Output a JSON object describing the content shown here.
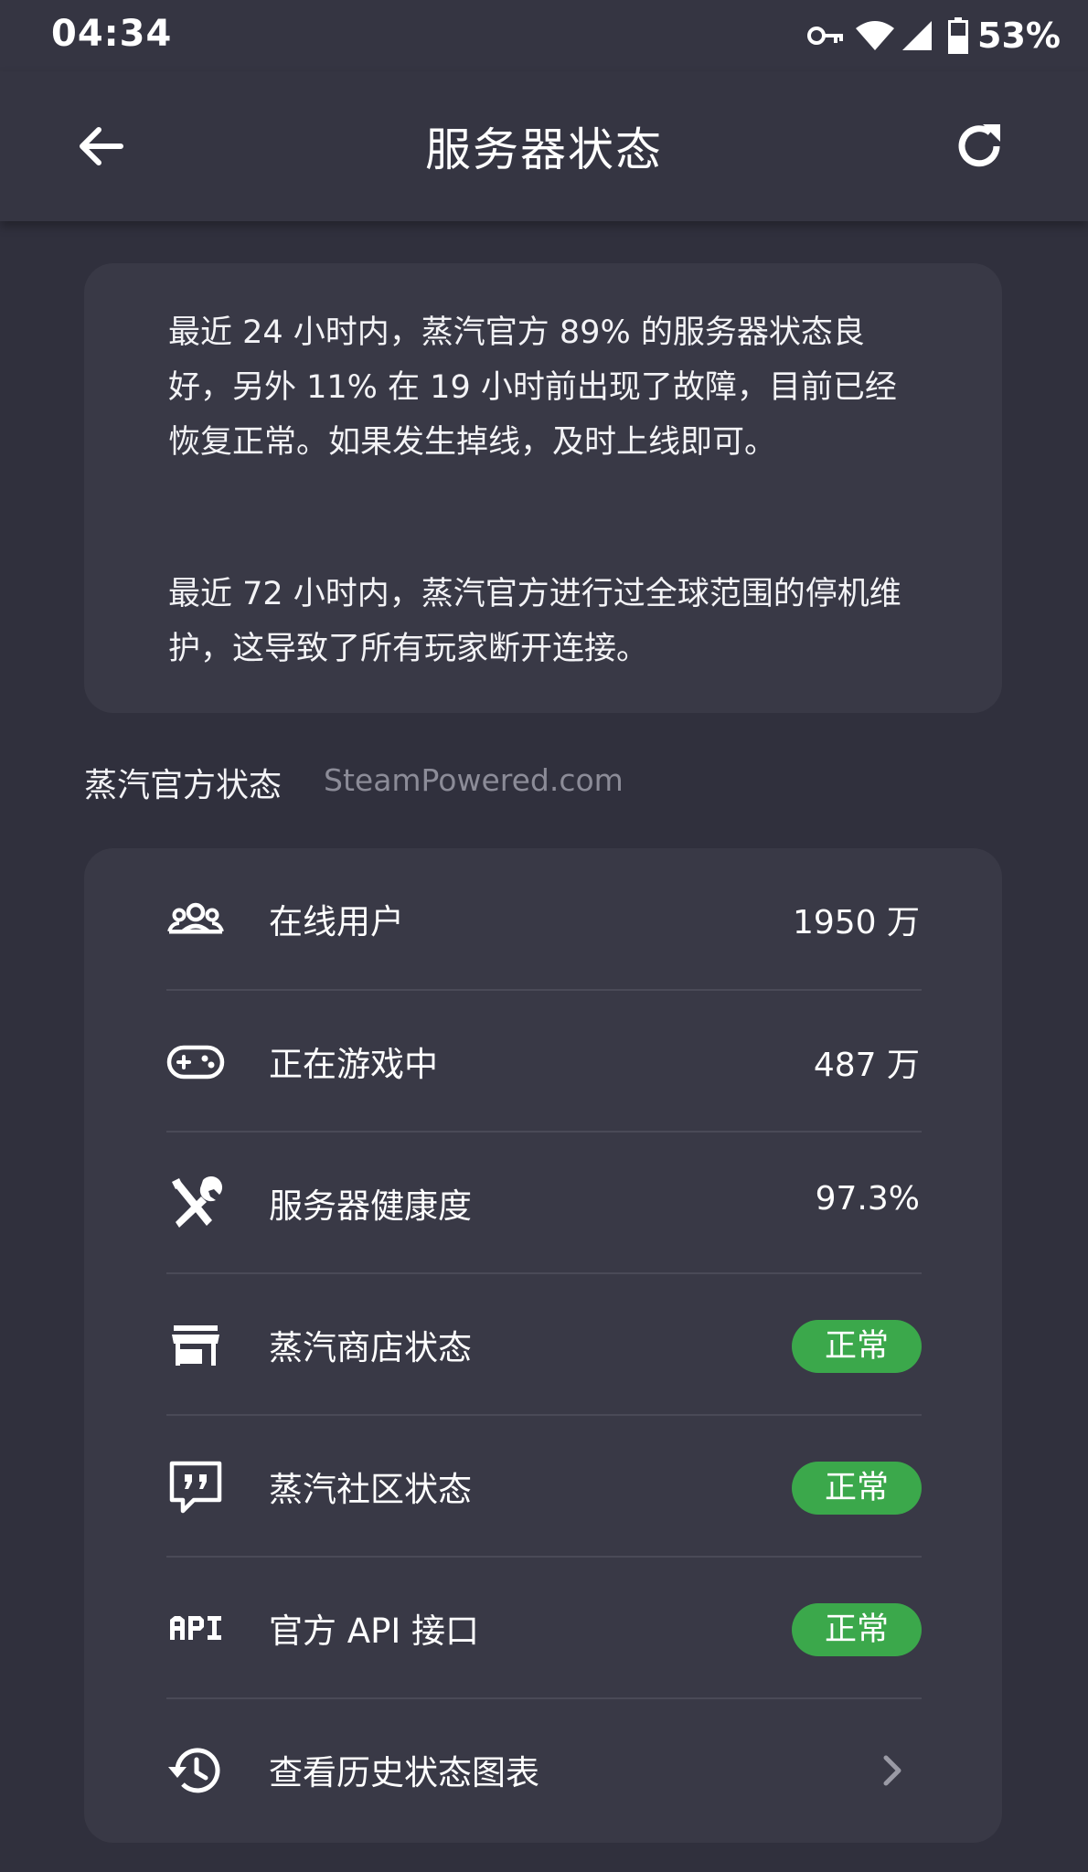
{
  "status_bar": {
    "time": "04:34",
    "battery": "53%",
    "icons": [
      "vpn-key-icon",
      "wifi-icon",
      "signal-icon",
      "battery-icon"
    ]
  },
  "app_bar": {
    "title": "服务器状态",
    "back_icon": "arrow-left-icon",
    "refresh_icon": "refresh-icon"
  },
  "summary": {
    "paragraph1": "最近 24 小时内，蒸汽官方 89% 的服务器状态良好，另外 11% 在 19 小时前出现了故障，目前已经恢复正常。如果发生掉线，及时上线即可。",
    "paragraph2": "最近 72 小时内，蒸汽官方进行过全球范围的停机维护，这导致了所有玩家断开连接。"
  },
  "section": {
    "title": "蒸汽官方状态",
    "subtitle": "SteamPowered.com"
  },
  "rows": [
    {
      "icon": "users-icon",
      "label": "在线用户",
      "value": "1950 万"
    },
    {
      "icon": "gamepad-icon",
      "label": "正在游戏中",
      "value": "487 万"
    },
    {
      "icon": "tools-icon",
      "label": "服务器健康度",
      "value": "97.3%"
    },
    {
      "icon": "store-icon",
      "label": "蒸汽商店状态",
      "badge": "正常"
    },
    {
      "icon": "chat-quote-icon",
      "label": "蒸汽社区状态",
      "badge": "正常"
    },
    {
      "icon": "api-icon",
      "label": "官方 API 接口",
      "badge": "正常"
    },
    {
      "icon": "history-icon",
      "label": "查看历史状态图表",
      "action_icon": "chevron-right-icon"
    }
  ],
  "colors": {
    "background": "#30303d",
    "bar": "#353542",
    "card": "#393946",
    "badge_green": "#3ba84b",
    "muted_text": "#8c8c98"
  }
}
